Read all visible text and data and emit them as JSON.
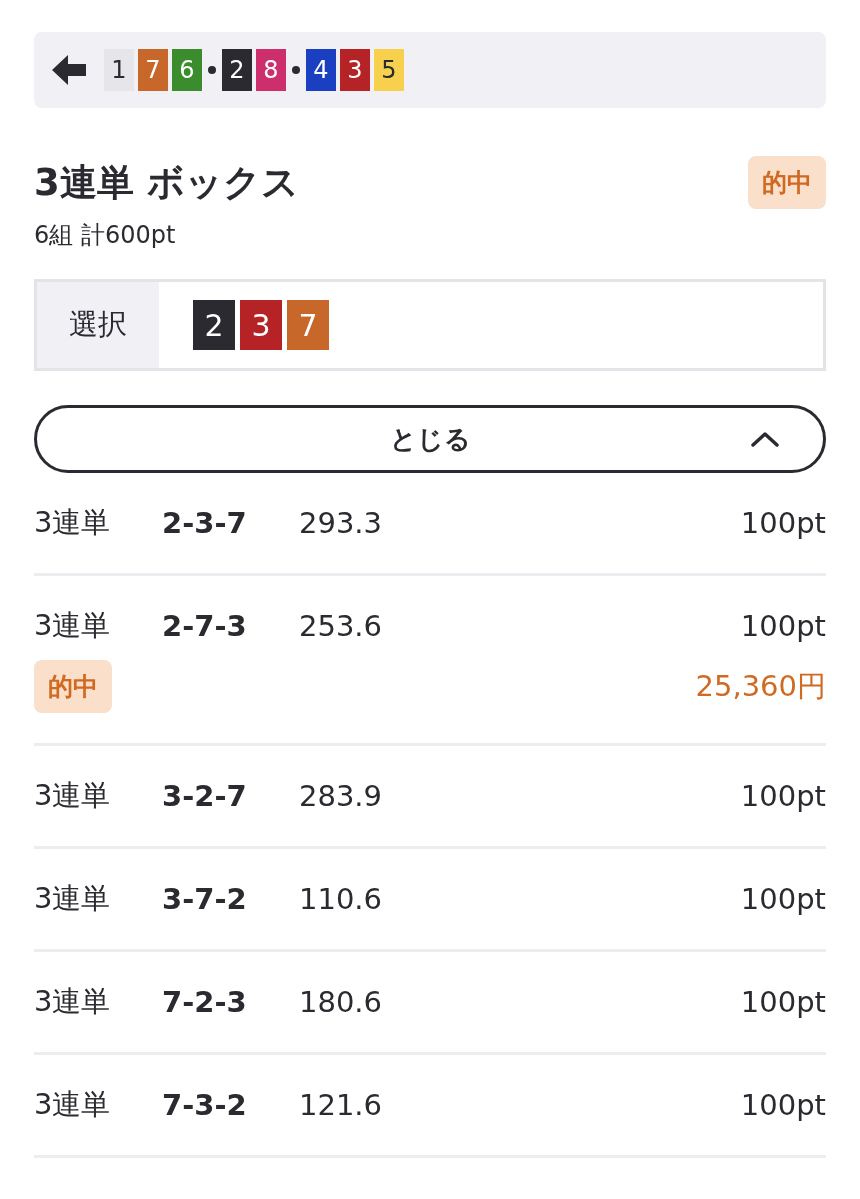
{
  "result_bar": {
    "groups": [
      [
        {
          "number": "1",
          "color": "#e6e6ea"
        },
        {
          "number": "7",
          "color": "#c8672a"
        },
        {
          "number": "6",
          "color": "#3a8c2c"
        }
      ],
      [
        {
          "number": "2",
          "color": "#2a2a30"
        },
        {
          "number": "8",
          "color": "#cc2f6c"
        }
      ],
      [
        {
          "number": "4",
          "color": "#1a3fc0"
        },
        {
          "number": "3",
          "color": "#b52326"
        },
        {
          "number": "5",
          "color": "#f7d04e"
        }
      ]
    ]
  },
  "bet": {
    "title": "3連単 ボックス",
    "hit": true,
    "hit_label": "的中",
    "summary": "6組 計600pt"
  },
  "selection": {
    "label": "選択",
    "numbers": [
      {
        "number": "2",
        "color": "#2a2a30"
      },
      {
        "number": "3",
        "color": "#b52326"
      },
      {
        "number": "7",
        "color": "#c8672a"
      }
    ]
  },
  "toggle_button": {
    "label": "とじる",
    "expanded": true
  },
  "rows": [
    {
      "bet_type": "3連単",
      "combination": "2-3-7",
      "odds": "293.3",
      "stake": "100pt",
      "hit": false
    },
    {
      "bet_type": "3連単",
      "combination": "2-7-3",
      "odds": "253.6",
      "stake": "100pt",
      "hit": true,
      "hit_label": "的中",
      "payout": "25,360円"
    },
    {
      "bet_type": "3連単",
      "combination": "3-2-7",
      "odds": "283.9",
      "stake": "100pt",
      "hit": false
    },
    {
      "bet_type": "3連単",
      "combination": "3-7-2",
      "odds": "110.6",
      "stake": "100pt",
      "hit": false
    },
    {
      "bet_type": "3連単",
      "combination": "7-2-3",
      "odds": "180.6",
      "stake": "100pt",
      "hit": false
    },
    {
      "bet_type": "3連単",
      "combination": "7-3-2",
      "odds": "121.6",
      "stake": "100pt",
      "hit": false
    }
  ]
}
